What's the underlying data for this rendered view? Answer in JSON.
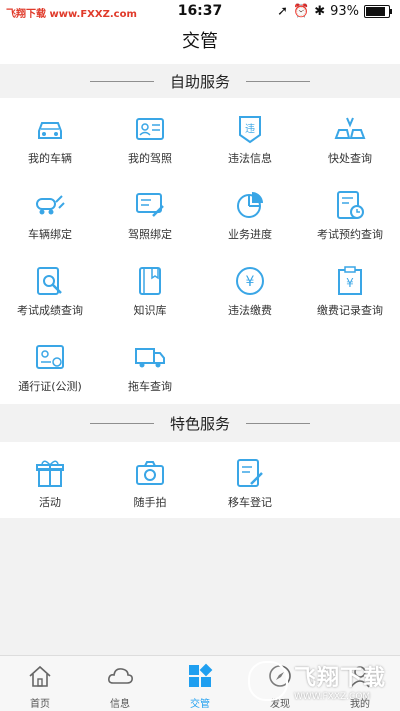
{
  "status_bar": {
    "watermark": "飞翔下载 www.FXXZ.com",
    "time": "16:37",
    "battery": "93%",
    "battery_level": 0.93
  },
  "nav": {
    "title": "交管"
  },
  "sections": {
    "self_service": {
      "title": "自助服务",
      "items": [
        {
          "label": "我的车辆",
          "icon": "car-icon"
        },
        {
          "label": "我的驾照",
          "icon": "license-card-icon"
        },
        {
          "label": "违法信息",
          "icon": "violation-badge-icon"
        },
        {
          "label": "快处查询",
          "icon": "accident-cars-icon"
        },
        {
          "label": "车辆绑定",
          "icon": "car-link-icon"
        },
        {
          "label": "驾照绑定",
          "icon": "license-link-icon"
        },
        {
          "label": "业务进度",
          "icon": "pie-chart-icon"
        },
        {
          "label": "考试预约查询",
          "icon": "exam-clock-icon"
        },
        {
          "label": "考试成绩查询",
          "icon": "document-search-icon"
        },
        {
          "label": "知识库",
          "icon": "book-icon"
        },
        {
          "label": "违法缴费",
          "icon": "yuan-coin-icon"
        },
        {
          "label": "缴费记录查询",
          "icon": "payment-record-icon"
        },
        {
          "label": "通行证(公测)",
          "icon": "pass-card-icon"
        },
        {
          "label": "拖车查询",
          "icon": "tow-truck-icon"
        }
      ]
    },
    "special_service": {
      "title": "特色服务",
      "items": [
        {
          "label": "活动",
          "icon": "gift-icon"
        },
        {
          "label": "随手拍",
          "icon": "camera-icon"
        },
        {
          "label": "移车登记",
          "icon": "form-edit-icon"
        }
      ]
    }
  },
  "tabbar": {
    "tabs": [
      {
        "label": "首页",
        "icon": "home-icon"
      },
      {
        "label": "信息",
        "icon": "cloud-icon"
      },
      {
        "label": "交管",
        "icon": "grid-icon",
        "active": true
      },
      {
        "label": "发现",
        "icon": "compass-icon"
      },
      {
        "label": "我的",
        "icon": "person-icon"
      }
    ]
  },
  "watermark_bottom": {
    "text": "飞翔下载",
    "url": "WWW.FXXZ.COM"
  },
  "colors": {
    "accent": "#1f9ff0",
    "icon_blue": "#3aa6e6"
  }
}
